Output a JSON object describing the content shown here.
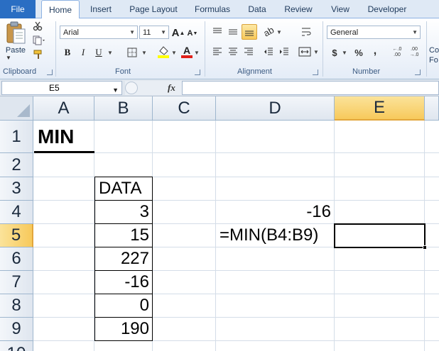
{
  "tabs": {
    "file": "File",
    "items": [
      "Home",
      "Insert",
      "Page Layout",
      "Formulas",
      "Data",
      "Review",
      "View",
      "Developer"
    ],
    "active": "Home"
  },
  "ribbon": {
    "clipboard": {
      "label": "Clipboard",
      "paste": "Paste"
    },
    "font": {
      "label": "Font",
      "family": "Arial",
      "size": "11",
      "grow": "A",
      "shrink": "A",
      "bold": "B",
      "italic": "I",
      "underline": "U",
      "font_color_letter": "A"
    },
    "alignment": {
      "label": "Alignment"
    },
    "number": {
      "label": "Number",
      "format": "General",
      "currency": "$",
      "percent": "%",
      "comma": ",",
      "inc_decimal": "←.0 .00",
      "dec_decimal": ".00 →.0"
    },
    "styles": {
      "partial_1": "Co",
      "partial_2": "Fo"
    }
  },
  "formula_bar": {
    "name_box": "E5",
    "fx": "fx",
    "content": ""
  },
  "columns": [
    "A",
    "B",
    "C",
    "D",
    "E"
  ],
  "selected_column": "E",
  "rows": [
    "1",
    "2",
    "3",
    "4",
    "5",
    "6",
    "7",
    "8",
    "9",
    "10"
  ],
  "selected_row": "5",
  "cells": {
    "A1": "MIN",
    "B3": "DATA",
    "B4": "3",
    "B5": "15",
    "B6": "227",
    "B7": "-16",
    "B8": "0",
    "B9": "190",
    "D4": "-16",
    "D5": "=MIN(B4:B9)"
  },
  "colors": {
    "file_tab": "#2a6ec3",
    "selection_header": "#f7c95b",
    "grid_line": "#d4dde8"
  }
}
